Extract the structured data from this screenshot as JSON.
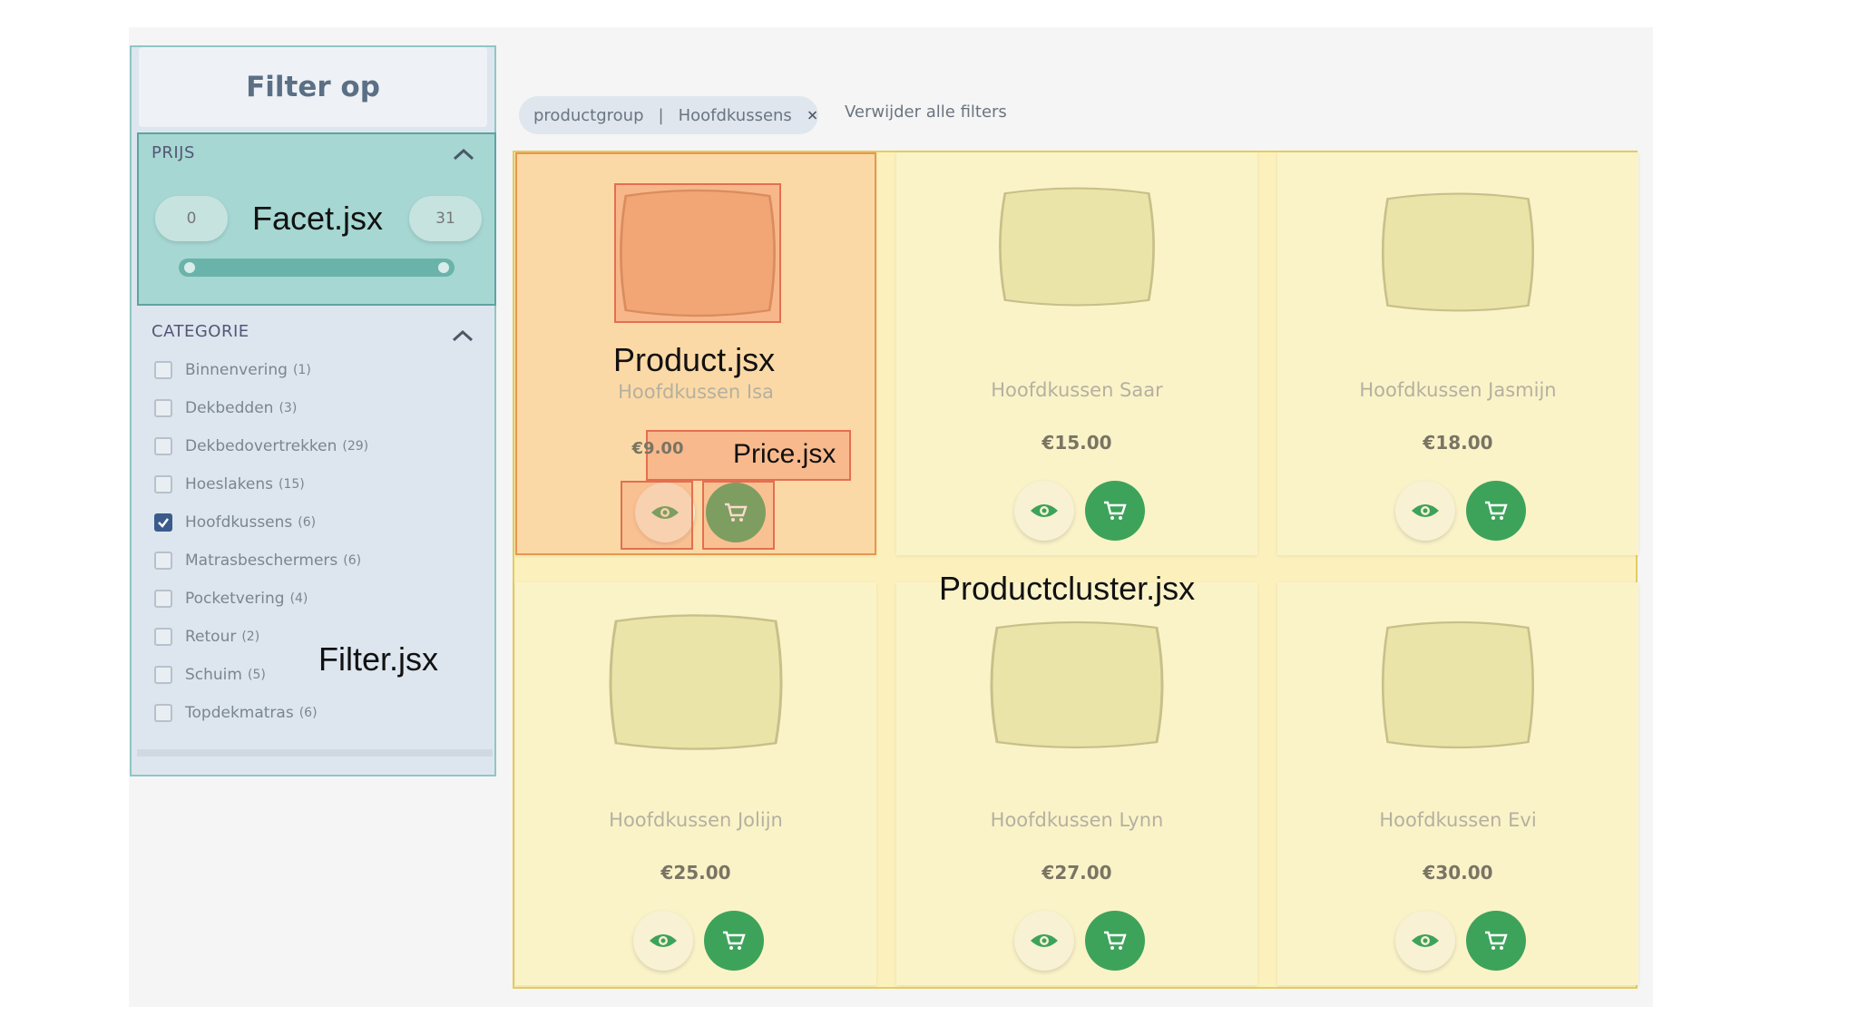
{
  "sidebar": {
    "title": "Filter op",
    "price_facet": {
      "label": "PRIJS",
      "min": "0",
      "max": "31",
      "overlay_label": "Facet.jsx"
    },
    "category": {
      "label": "CATEGORIE",
      "items": [
        {
          "name": "Binnenvering",
          "count": "(1)",
          "checked": false
        },
        {
          "name": "Dekbedden",
          "count": "(3)",
          "checked": false
        },
        {
          "name": "Dekbedovertrekken",
          "count": "(29)",
          "checked": false
        },
        {
          "name": "Hoeslakens",
          "count": "(15)",
          "checked": false
        },
        {
          "name": "Hoofdkussens",
          "count": "(6)",
          "checked": true
        },
        {
          "name": "Matrasbeschermers",
          "count": "(6)",
          "checked": false
        },
        {
          "name": "Pocketvering",
          "count": "(4)",
          "checked": false
        },
        {
          "name": "Retour",
          "count": "(2)",
          "checked": false
        },
        {
          "name": "Schuim",
          "count": "(5)",
          "checked": false
        },
        {
          "name": "Topdekmatras",
          "count": "(6)",
          "checked": false
        }
      ]
    },
    "overlay_label": "Filter.jsx"
  },
  "active_filter": {
    "group": "productgroup",
    "separator": "|",
    "value": "Hoofdkussens",
    "remove_icon": "close-icon"
  },
  "clear_filters_label": "Verwijder alle filters",
  "cluster_overlay_label": "Productcluster.jsx",
  "product_overlay_label": "Product.jsx",
  "price_overlay_label": "Price.jsx",
  "products": [
    {
      "name": "Hoofdkussen Isa",
      "price": "€9.00"
    },
    {
      "name": "Hoofdkussen Saar",
      "price": "€15.00"
    },
    {
      "name": "Hoofdkussen Jasmijn",
      "price": "€18.00"
    },
    {
      "name": "Hoofdkussen Jolijn",
      "price": "€25.00"
    },
    {
      "name": "Hoofdkussen Lynn",
      "price": "€27.00"
    },
    {
      "name": "Hoofdkussen Evi",
      "price": "€30.00"
    }
  ],
  "colors": {
    "cluster_highlight": "#fcf1bc",
    "product_highlight": "#fbd9a6",
    "facet_highlight": "#a6d7d2",
    "cart_button": "#3da35a"
  }
}
